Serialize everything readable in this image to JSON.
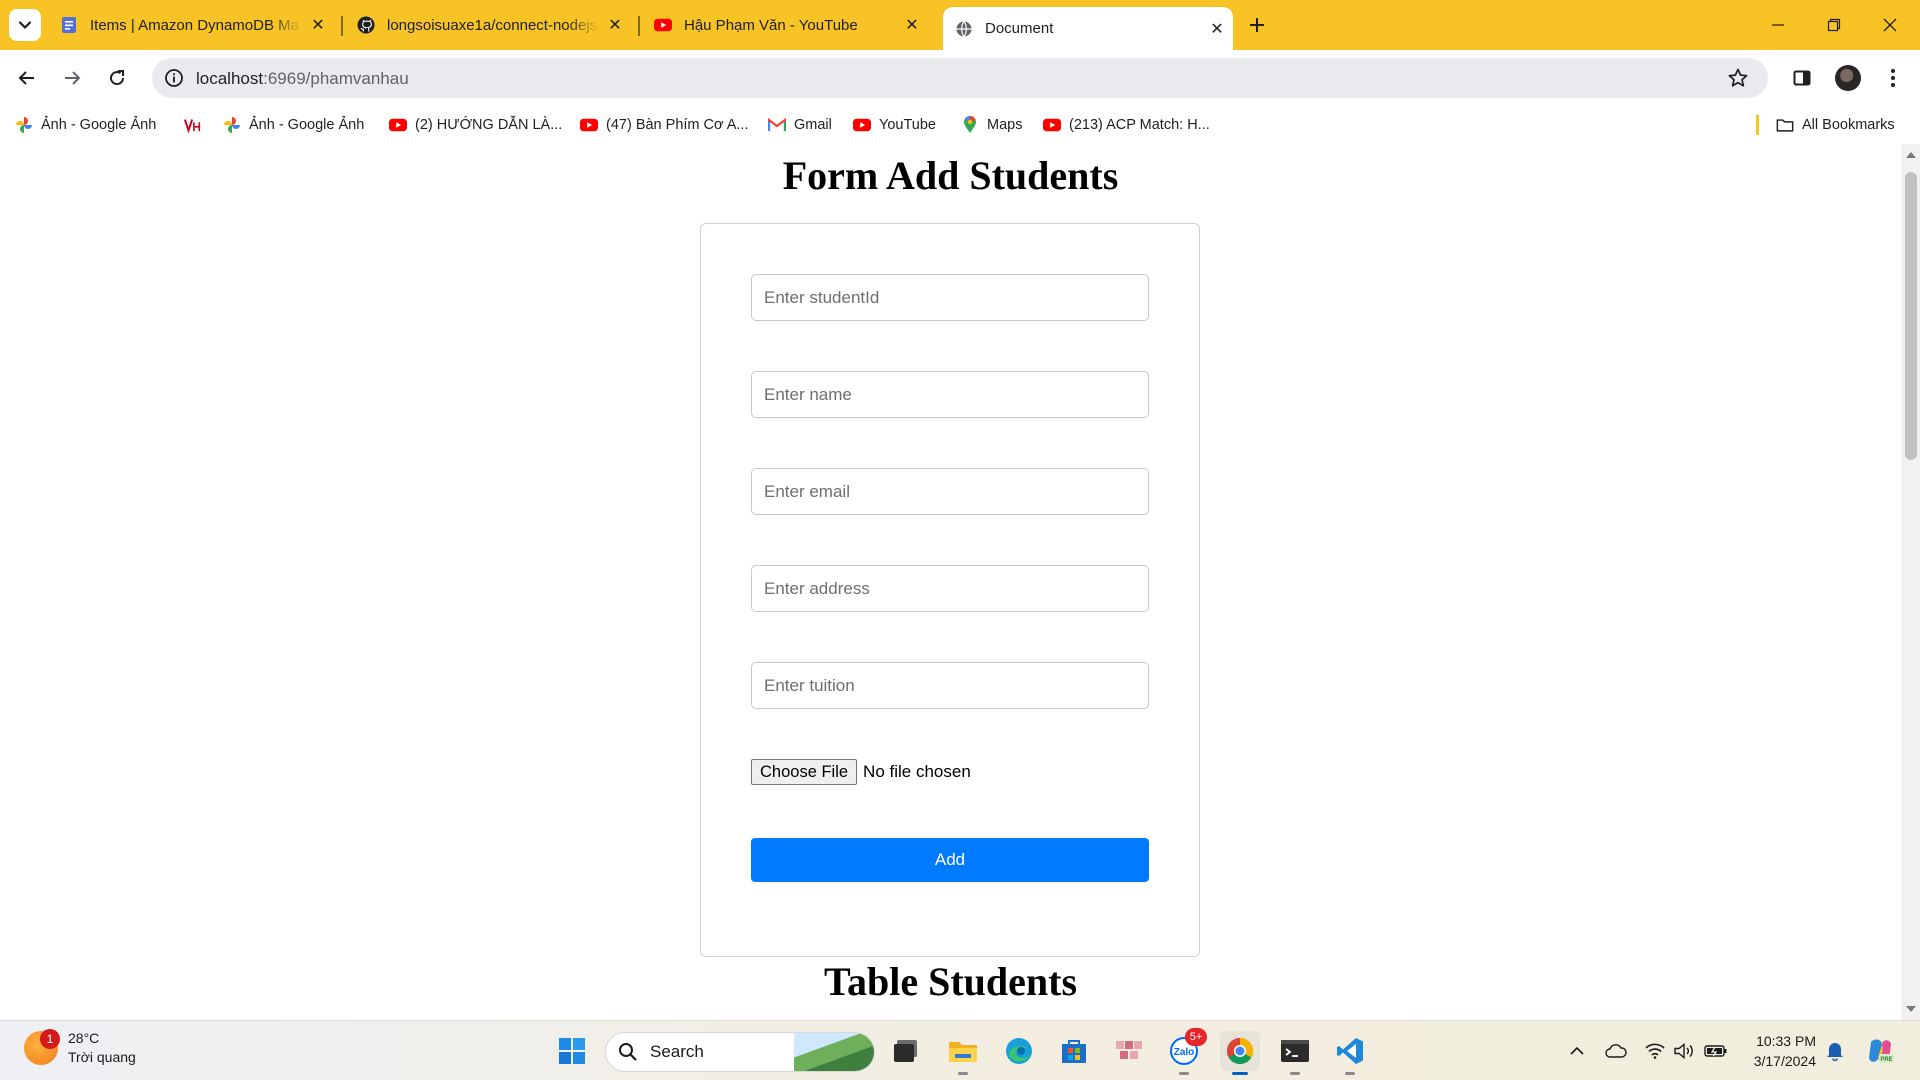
{
  "browser": {
    "tabs": [
      {
        "title": "Items | Amazon DynamoDB Ma",
        "icon": "dynamodb-doc-icon",
        "active": false
      },
      {
        "title": "longsoisuaxe1a/connect-nodejs",
        "icon": "github-icon",
        "active": false
      },
      {
        "title": "Hậu Phạm Văn - YouTube",
        "icon": "youtube-icon",
        "active": false
      },
      {
        "title": "Document",
        "icon": "globe-icon",
        "active": true
      }
    ],
    "address": {
      "host": "localhost",
      "path": ":6969/phamvanhau"
    },
    "bookmarks": [
      {
        "label": "Ảnh - Google Ảnh",
        "icon": "google-photos-icon"
      },
      {
        "label": "",
        "icon": "vh-logo-icon"
      },
      {
        "label": "Ảnh - Google Ảnh",
        "icon": "google-photos-icon"
      },
      {
        "label": "(2) HƯỚNG DẪN LÀ...",
        "icon": "youtube-icon"
      },
      {
        "label": "(47) Bàn Phím Cơ A...",
        "icon": "youtube-icon"
      },
      {
        "label": "Gmail",
        "icon": "gmail-icon"
      },
      {
        "label": "YouTube",
        "icon": "youtube-icon"
      },
      {
        "label": "Maps",
        "icon": "maps-icon"
      },
      {
        "label": "(213) ACP Match: H...",
        "icon": "youtube-icon"
      }
    ],
    "all_bookmarks": "All Bookmarks",
    "accent_color": "#f7c325"
  },
  "page": {
    "form_title": "Form Add Students",
    "fields": {
      "student_id": "Enter studentId",
      "name": "Enter name",
      "email": "Enter email",
      "address": "Enter address",
      "tuition": "Enter tuition"
    },
    "file_button": "Choose File",
    "file_status": "No file chosen",
    "add_button": "Add",
    "add_button_color": "#007bff",
    "table_title": "Table Students"
  },
  "taskbar": {
    "weather": {
      "badge": "1",
      "temp": "28°C",
      "condition": "Trời quang"
    },
    "search_label": "Search",
    "zalo_badge": "5+",
    "time": "10:33 PM",
    "date": "3/17/2024"
  }
}
